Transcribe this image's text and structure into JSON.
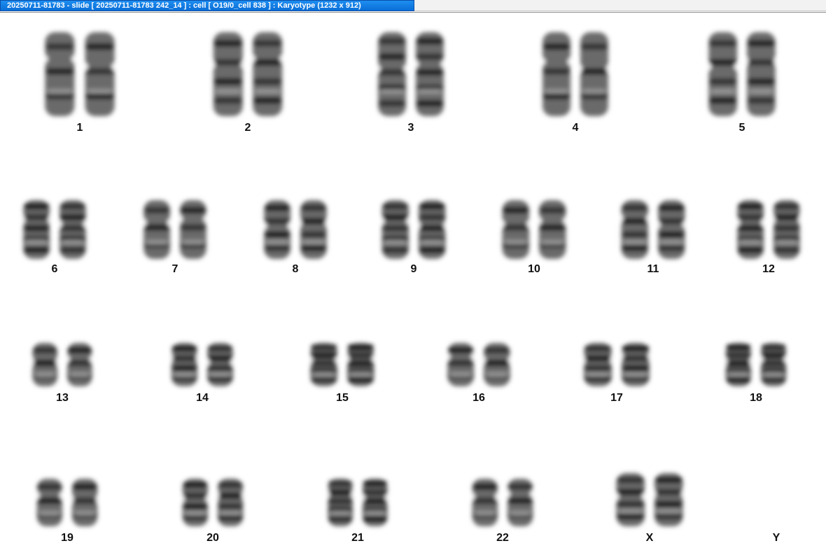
{
  "window": {
    "title": "20250711-81783 - slide [ 20250711-81783 242_14 ] : cell [ O19/0_cell 838 ] : Karyotype  (1232 x 912)"
  },
  "karyotype": {
    "chromosomes": [
      {
        "label": "1",
        "pair": true
      },
      {
        "label": "2",
        "pair": true
      },
      {
        "label": "3",
        "pair": true
      },
      {
        "label": "4",
        "pair": true
      },
      {
        "label": "5",
        "pair": true
      },
      {
        "label": "6",
        "pair": true
      },
      {
        "label": "7",
        "pair": true
      },
      {
        "label": "8",
        "pair": true
      },
      {
        "label": "9",
        "pair": true
      },
      {
        "label": "10",
        "pair": true
      },
      {
        "label": "11",
        "pair": true
      },
      {
        "label": "12",
        "pair": true
      },
      {
        "label": "13",
        "pair": true
      },
      {
        "label": "14",
        "pair": true
      },
      {
        "label": "15",
        "pair": true
      },
      {
        "label": "16",
        "pair": true
      },
      {
        "label": "17",
        "pair": true
      },
      {
        "label": "18",
        "pair": true
      },
      {
        "label": "19",
        "pair": true
      },
      {
        "label": "20",
        "pair": true
      },
      {
        "label": "21",
        "pair": true
      },
      {
        "label": "22",
        "pair": true
      },
      {
        "label": "X",
        "pair": true
      },
      {
        "label": "Y",
        "pair": false
      }
    ]
  }
}
